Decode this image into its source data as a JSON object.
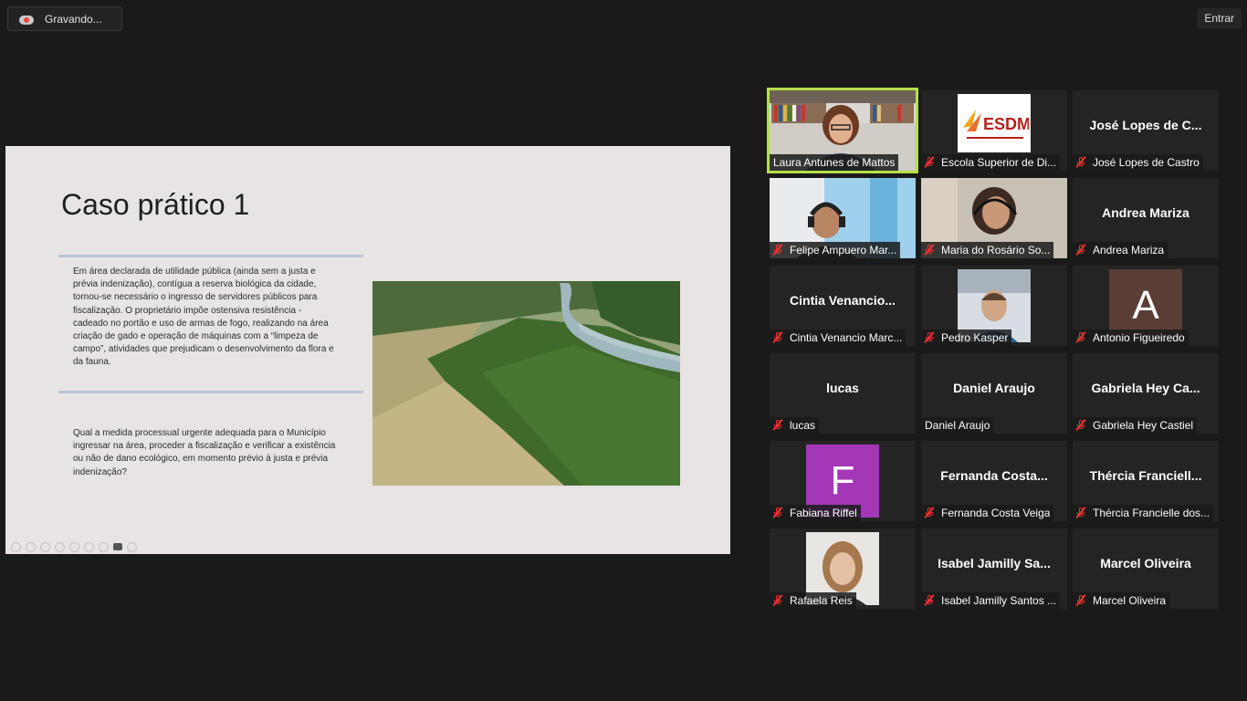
{
  "recording": {
    "label": "Gravando..."
  },
  "topbar": {
    "enter_label": "Entrar"
  },
  "slide": {
    "title": "Caso prático 1",
    "paragraph1": "Em área declarada de utilidade pública (ainda sem a justa e prévia indenização), contígua a reserva biológica da cidade, tornou-se necessário o ingresso de servidores públicos para fiscalização. O proprietário impõe ostensiva resistência  - cadeado no portão e uso de armas de fogo, realizando na área criação de gado e operação de máquinas com a “limpeza de campo”, atividades que prejudicam o desenvolvimento da flora e da fauna.",
    "paragraph2": "Qual a medida processual urgente adequada para o Município ingressar na área, proceder a fiscalização e verificar a existência ou não de dano ecológico, em momento prévio à justa e prévia indenização?"
  },
  "participants": [
    {
      "name": "Laura Antunes de Mattos",
      "label": "Laura Antunes de Mattos",
      "muted": false,
      "video": "woman-bookshelf",
      "active": true
    },
    {
      "name": "Escola Superior de Direito Municipal",
      "label": "Escola Superior de Di...",
      "muted": true,
      "video": "esdm-logo",
      "logo_text": "ESDM"
    },
    {
      "name": "José Lopes de C...",
      "label": "José Lopes de Castro",
      "muted": true,
      "video": "none"
    },
    {
      "name": "Felipe Ampuero Mar...",
      "label": "Felipe Ampuero Mar...",
      "muted": true,
      "video": "man-headset"
    },
    {
      "name": "Maria do Rosário So...",
      "label": "Maria do Rosário So...",
      "muted": true,
      "video": "woman-headset"
    },
    {
      "name": "Andrea Mariza",
      "label": "Andrea Mariza",
      "muted": true,
      "video": "none"
    },
    {
      "name": "Cintia  Venancio...",
      "label": "Cintia Venancio Marc...",
      "muted": true,
      "video": "none"
    },
    {
      "name": "Pedro Kasper",
      "label": "Pedro Kasper",
      "muted": true,
      "video": "man-car"
    },
    {
      "name": "Antonio Figueiredo",
      "label": "Antonio Figueiredo",
      "muted": true,
      "video": "avatar",
      "initial": "A",
      "color": "#5a3e36"
    },
    {
      "name": "lucas",
      "label": "lucas",
      "muted": true,
      "video": "none"
    },
    {
      "name": "Daniel Araujo",
      "label": "Daniel Araujo",
      "muted": false,
      "video": "none"
    },
    {
      "name": "Gabriela  Hey  Ca...",
      "label": "Gabriela Hey Castiel",
      "muted": true,
      "video": "none"
    },
    {
      "name": "Fabiana Riffel",
      "label": "Fabiana Riffel",
      "muted": true,
      "video": "avatar",
      "initial": "F",
      "color": "#a437b8"
    },
    {
      "name": "Fernanda  Costa...",
      "label": "Fernanda Costa Veiga",
      "muted": true,
      "video": "none"
    },
    {
      "name": "Thércia  Franciell...",
      "label": "Thércia Francielle dos...",
      "muted": true,
      "video": "none"
    },
    {
      "name": "Rafaela Reis",
      "label": "Rafaela Reis",
      "muted": true,
      "video": "woman-photo"
    },
    {
      "name": "Isabel  Jamilly  Sa...",
      "label": "Isabel Jamilly Santos ...",
      "muted": true,
      "video": "none"
    },
    {
      "name": "Marcel Oliveira",
      "label": "Marcel Oliveira",
      "muted": true,
      "video": "none"
    }
  ]
}
